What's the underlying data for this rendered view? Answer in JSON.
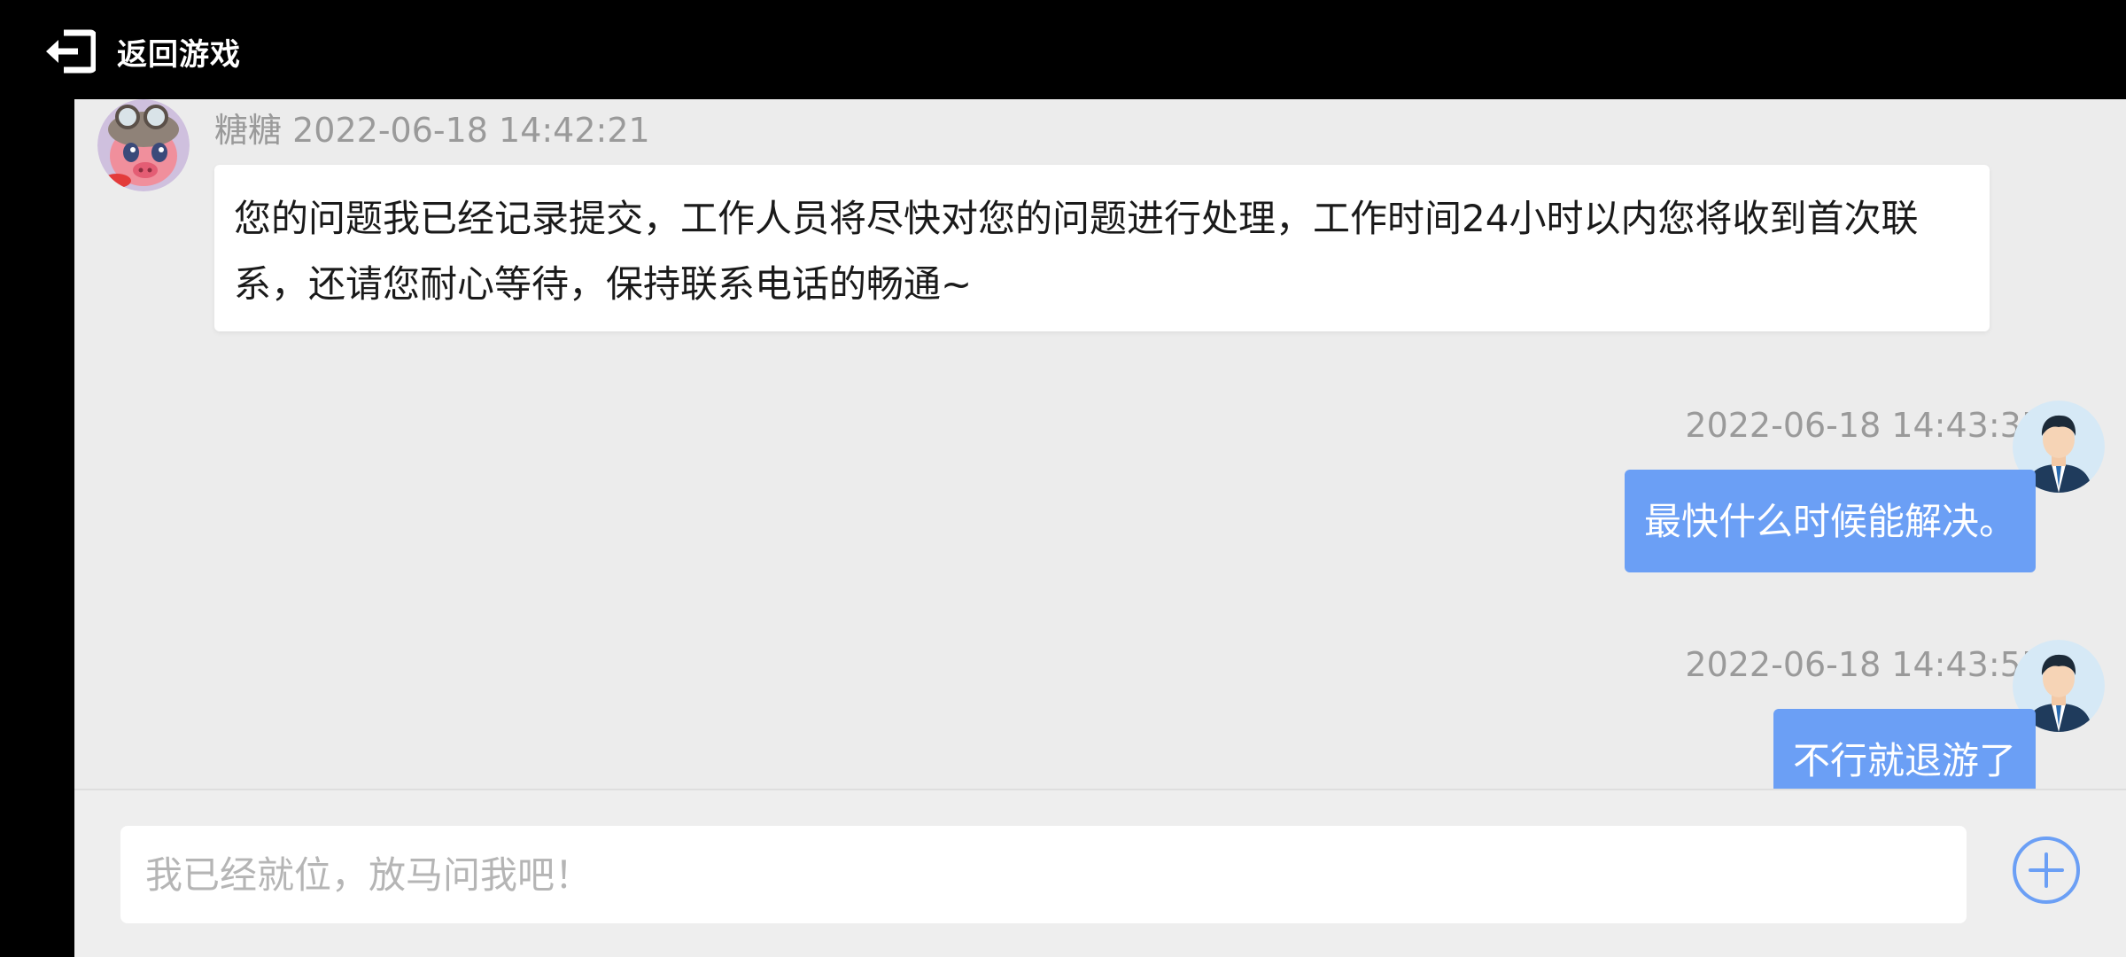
{
  "header": {
    "back_label": "返回游戏",
    "back_icon": "exit-icon"
  },
  "messages": [
    {
      "direction": "incoming",
      "sender": "糖糖",
      "time": "2022-06-18 14:42:21",
      "text": "您的问题我已经记录提交，工作人员将尽快对您的问题进行处理，工作时间24小时以内您将收到首次联系，还请您耐心等待，保持联系电话的畅通~"
    },
    {
      "direction": "outgoing",
      "time": "2022-06-18 14:43:35",
      "text": "最快什么时候能解决。"
    },
    {
      "direction": "outgoing",
      "time": "2022-06-18 14:43:55",
      "text": "不行就退游了"
    }
  ],
  "composer": {
    "placeholder": "我已经就位，放马问我吧！",
    "value": "",
    "add_icon": "plus-circle-icon"
  },
  "colors": {
    "accent": "#6b9ff5",
    "chat_background": "#ececec",
    "incoming_bubble": "#ffffff",
    "timestamp": "#9a9a9a",
    "topbar": "#000000"
  }
}
